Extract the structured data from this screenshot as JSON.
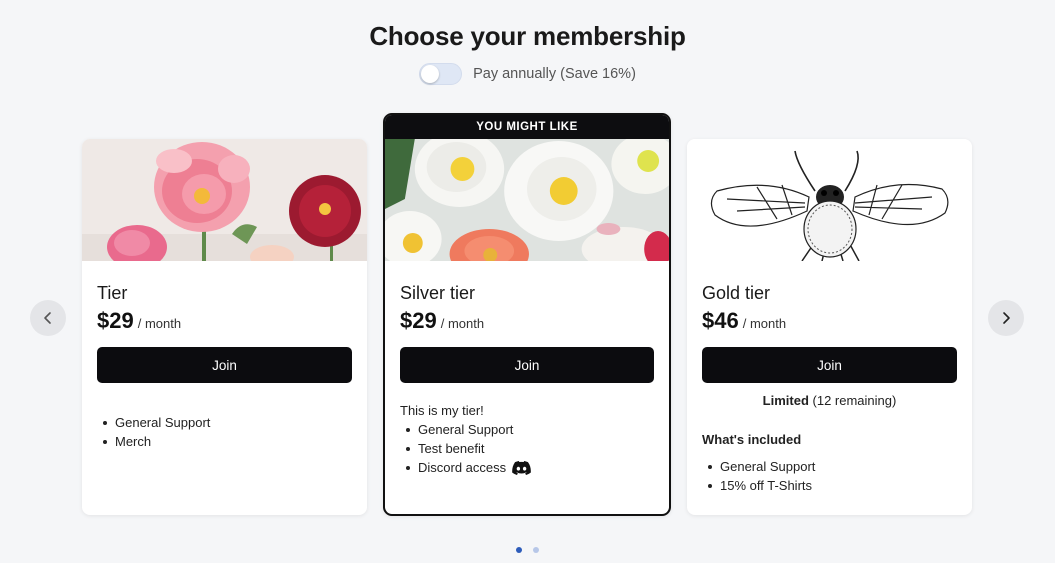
{
  "header": {
    "title": "Choose your membership",
    "toggle_label": "Pay annually (Save 16%)"
  },
  "cards": [
    {
      "name": "Tier",
      "price": "$29",
      "period": "/ month",
      "join_label": "Join",
      "benefits": [
        "General Support",
        "Merch"
      ]
    },
    {
      "ribbon": "YOU MIGHT LIKE",
      "name": "Silver tier",
      "price": "$29",
      "period": "/ month",
      "join_label": "Join",
      "description": "This is my tier!",
      "benefits": [
        "General Support",
        "Test benefit",
        "Discord access"
      ]
    },
    {
      "name": "Gold tier",
      "price": "$46",
      "period": "/ month",
      "join_label": "Join",
      "limited_label": "Limited",
      "limited_remaining": "(12 remaining)",
      "included_heading": "What's included",
      "benefits": [
        "General Support",
        "15% off T-Shirts"
      ]
    }
  ],
  "pagination": {
    "pages": 2,
    "active": 1
  },
  "icons": {
    "prev": "chevron-left-icon",
    "next": "chevron-right-icon",
    "discord": "discord-icon"
  },
  "colors": {
    "button": "#0c0c0f",
    "dot_active": "#2d5cba",
    "dot_inactive": "#b7c7e8",
    "toggle_track": "#dfe7f5"
  }
}
